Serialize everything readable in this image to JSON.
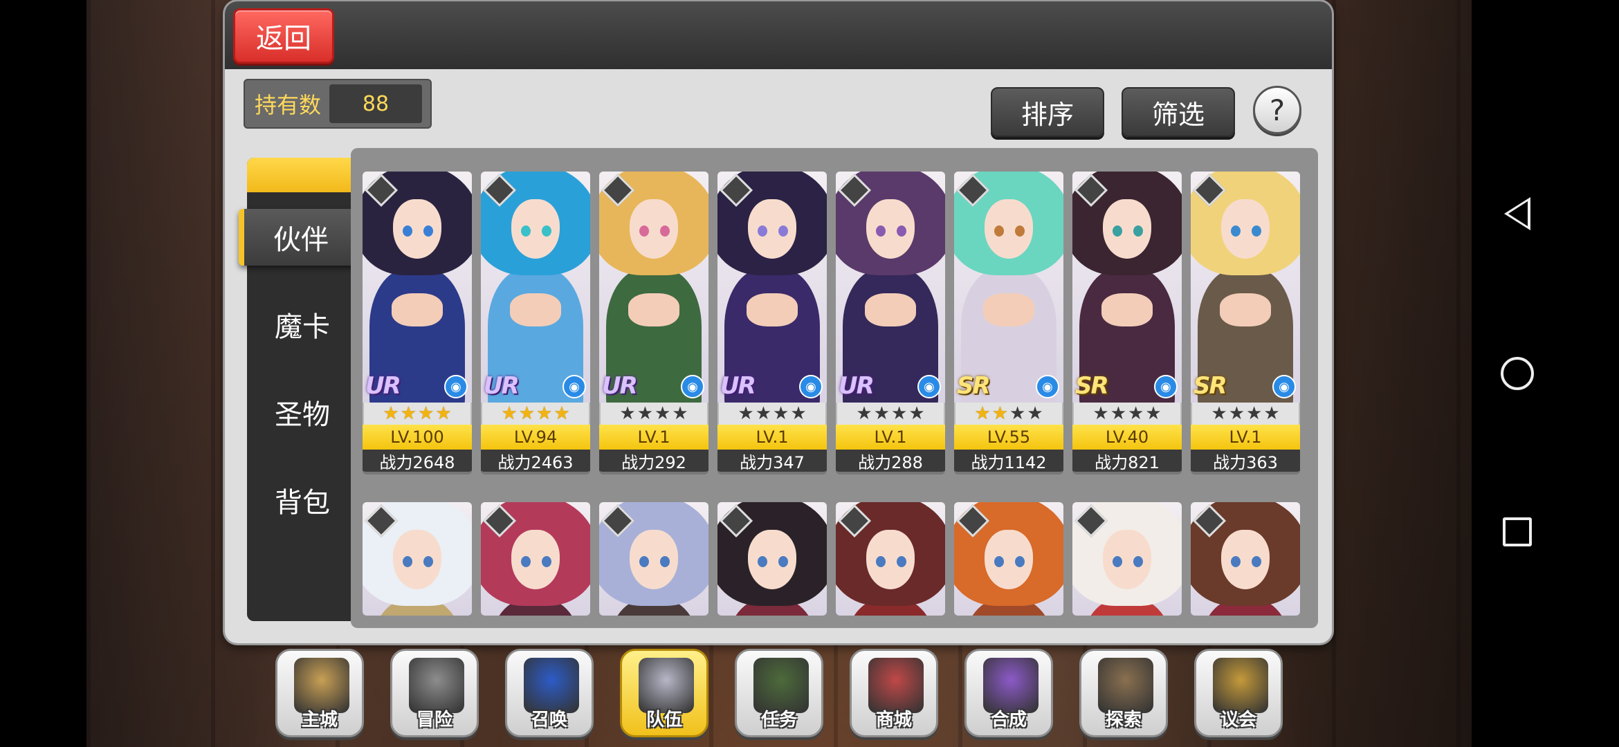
{
  "header": {
    "back_label": "返回"
  },
  "ownership": {
    "label": "持有数",
    "value": "88"
  },
  "toolbar": {
    "sort_label": "排序",
    "filter_label": "筛选",
    "help_label": "?"
  },
  "sidebar": {
    "tabs": [
      {
        "label": "伙伴",
        "active": true
      },
      {
        "label": "魔卡",
        "active": false
      },
      {
        "label": "圣物",
        "active": false
      },
      {
        "label": "背包",
        "active": false
      }
    ]
  },
  "cards_row1": [
    {
      "rarity": "UR",
      "stars": 4,
      "level": "LV.100",
      "power": "战力2648",
      "hair": "#2a2340",
      "outfit": "#2c3a8a",
      "eye": "#3a7fd6"
    },
    {
      "rarity": "UR",
      "stars": 4,
      "level": "LV.94",
      "power": "战力2463",
      "hair": "#2aa0d8",
      "outfit": "#5aa8e0",
      "eye": "#3ac0c8"
    },
    {
      "rarity": "UR",
      "stars": 0,
      "level": "LV.1",
      "power": "战力292",
      "hair": "#e8b65a",
      "outfit": "#3e6a40",
      "eye": "#d86a9a"
    },
    {
      "rarity": "UR",
      "stars": 0,
      "level": "LV.1",
      "power": "战力347",
      "hair": "#2b2245",
      "outfit": "#3a2a6a",
      "eye": "#8a7ad8"
    },
    {
      "rarity": "UR",
      "stars": 0,
      "level": "LV.1",
      "power": "战力288",
      "hair": "#5a3a6a",
      "outfit": "#35285a",
      "eye": "#8a5ab0"
    },
    {
      "rarity": "SR",
      "stars": 2,
      "level": "LV.55",
      "power": "战力1142",
      "hair": "#6ad6c0",
      "outfit": "#d8d0e0",
      "eye": "#c07a3a"
    },
    {
      "rarity": "SR",
      "stars": 0,
      "level": "LV.40",
      "power": "战力821",
      "hair": "#3a2530",
      "outfit": "#4a2a40",
      "eye": "#3aa0a0"
    },
    {
      "rarity": "SR",
      "stars": 0,
      "level": "LV.1",
      "power": "战力363",
      "hair": "#f0d27a",
      "outfit": "#6a5a4a",
      "eye": "#3a8ad0"
    }
  ],
  "cards_row2": [
    {
      "hair": "#eaf0f5",
      "outfit": "#c0a870"
    },
    {
      "hair": "#b43a5a",
      "outfit": "#5a2a3a"
    },
    {
      "hair": "#a8b0d8",
      "outfit": "#4a3a3a"
    },
    {
      "hair": "#2a2228",
      "outfit": "#7a2a3a"
    },
    {
      "hair": "#6a2a2a",
      "outfit": "#8a2a2a"
    },
    {
      "hair": "#d86a2a",
      "outfit": "#a04a2a"
    },
    {
      "hair": "#f2ede8",
      "outfit": "#c03a3a"
    },
    {
      "hair": "#6a3a2a",
      "outfit": "#8a2a3a"
    }
  ],
  "bottom_menu": [
    {
      "label": "主城",
      "icon": "crown-icon",
      "color": "#c9a055",
      "active": false
    },
    {
      "label": "冒险",
      "icon": "crossed-swords-icon",
      "color": "#8d8d8d",
      "active": false
    },
    {
      "label": "召唤",
      "icon": "summon-card-icon",
      "color": "#2d5cc7",
      "active": false
    },
    {
      "label": "队伍",
      "icon": "winged-helmet-icon",
      "color": "#b7b7c8",
      "active": true
    },
    {
      "label": "任务",
      "icon": "scroll-icon",
      "color": "#4d6b3a",
      "active": false
    },
    {
      "label": "商城",
      "icon": "shop-icon",
      "color": "#c04848",
      "active": false
    },
    {
      "label": "合成",
      "icon": "potion-icon",
      "color": "#8c5ac8",
      "active": false
    },
    {
      "label": "探索",
      "icon": "compass-icon",
      "color": "#8a7050",
      "active": false
    },
    {
      "label": "议会",
      "icon": "council-emblem-icon",
      "color": "#c59a3a",
      "active": false
    }
  ]
}
